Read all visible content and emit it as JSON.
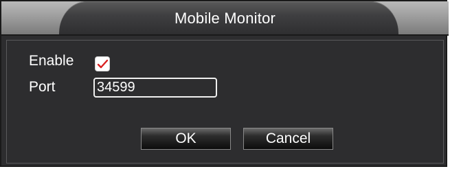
{
  "dialog": {
    "title": "Mobile Monitor",
    "enable_label": "Enable",
    "enable_checked": true,
    "port_label": "Port",
    "port_value": "34599",
    "ok_label": "OK",
    "cancel_label": "Cancel"
  },
  "colors": {
    "check_mark": "#d92020",
    "panel": "#2d2d2f"
  },
  "icons": {
    "checkbox": "check-icon"
  }
}
